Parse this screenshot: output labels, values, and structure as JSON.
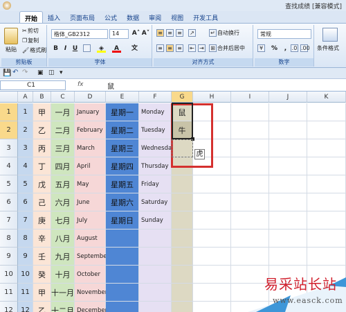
{
  "window": {
    "title": "查找成绩 [兼容模式]"
  },
  "tabs": [
    "开始",
    "插入",
    "页面布局",
    "公式",
    "数据",
    "审阅",
    "视图",
    "开发工具"
  ],
  "clipboard": {
    "cut": "剪切",
    "copy": "复制",
    "format_painter": "格式刷",
    "paste": "粘贴",
    "label": "剪贴板"
  },
  "font": {
    "name": "楷体_GB2312",
    "size": "14",
    "label": "字体",
    "bold": "B",
    "italic": "I",
    "underline": "U"
  },
  "alignment": {
    "wrap": "自动换行",
    "merge": "合并后居中",
    "label": "对齐方式"
  },
  "number": {
    "format": "常规",
    "label": "数字",
    "percent": "%"
  },
  "styles": {
    "conditional": "条件格式"
  },
  "formula_bar": {
    "name_box": "C1",
    "fx": "fx",
    "value": "鼠"
  },
  "columns": [
    "A",
    "B",
    "C",
    "D",
    "E",
    "F",
    "G",
    "H",
    "I",
    "J",
    "K"
  ],
  "rows": [
    "1",
    "2",
    "3",
    "4",
    "5",
    "6",
    "7",
    "8",
    "9",
    "10",
    "11",
    "12"
  ],
  "col_a": [
    "1",
    "2",
    "3",
    "4",
    "5",
    "6",
    "7",
    "8",
    "9",
    "10",
    "11",
    "12"
  ],
  "col_b": [
    "甲",
    "乙",
    "丙",
    "丁",
    "戊",
    "己",
    "庚",
    "辛",
    "壬",
    "癸",
    "甲",
    "乙"
  ],
  "col_c": [
    "一月",
    "二月",
    "三月",
    "四月",
    "五月",
    "六月",
    "七月",
    "八月",
    "九月",
    "十月",
    "十一月",
    "十二月"
  ],
  "col_d": [
    "January",
    "February",
    "March",
    "April",
    "May",
    "June",
    "July",
    "August",
    "September",
    "October",
    "November",
    "December"
  ],
  "col_e": [
    "星期一",
    "星期二",
    "星期三",
    "星期四",
    "星期五",
    "星期六",
    "星期日"
  ],
  "col_f": [
    "Monday",
    "Tuesday",
    "Wednesday",
    "Thursday",
    "Friday",
    "Saturday",
    "Sunday"
  ],
  "col_g": [
    "鼠",
    "牛"
  ],
  "fill_tooltip": "虎",
  "watermark": {
    "line1": "易采站长站",
    "line2": "www.easck.com"
  },
  "colors": {
    "col_a": "#c5d8ef",
    "col_b": "#fbe5d6",
    "col_c": "#cfe6bf",
    "col_d": "#f6d7d7",
    "col_e": "#4f86d4",
    "col_f": "#e6e0f3",
    "col_g": "#ddd9c3",
    "highlight": "#d4302e"
  }
}
